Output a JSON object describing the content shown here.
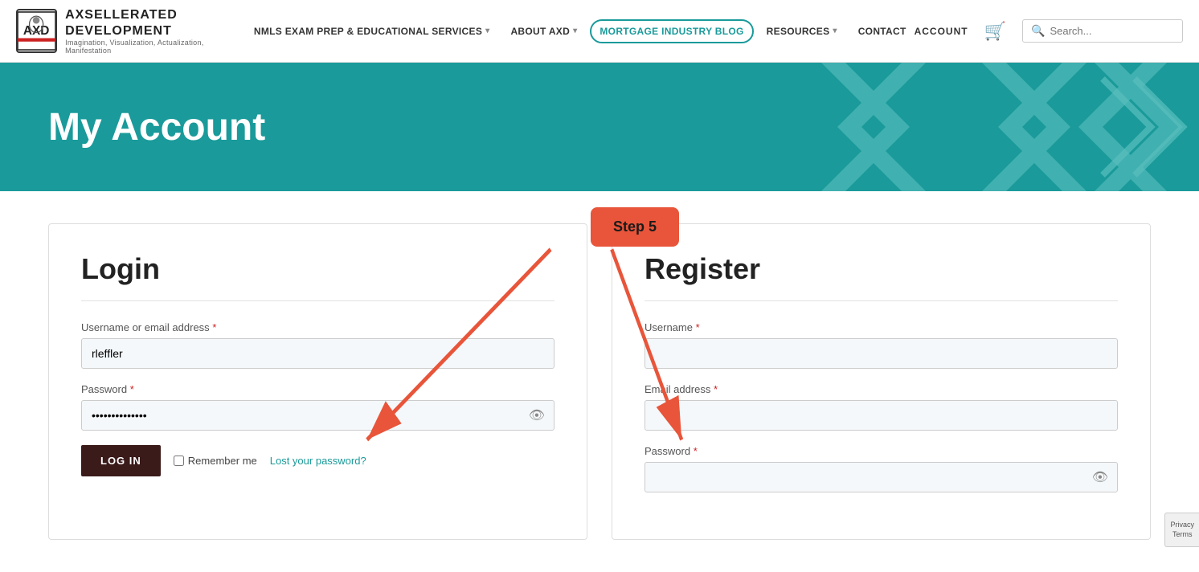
{
  "header": {
    "logo": {
      "abbr": "AXD",
      "title_line1": "AXSELLERATED",
      "title_line2": "DEVELOPMENT",
      "subtitle": "Imagination, Visualization, Actualization, Manifestation"
    },
    "nav": [
      {
        "id": "nmls",
        "label": "NMLS EXAM PREP & EDUCATIONAL SERVICES",
        "has_dropdown": true
      },
      {
        "id": "about",
        "label": "ABOUT AXD",
        "has_dropdown": true
      },
      {
        "id": "blog",
        "label": "MORTGAGE INDUSTRY BLOG",
        "has_dropdown": false,
        "outlined": true
      },
      {
        "id": "resources",
        "label": "RESOURCES",
        "has_dropdown": true
      },
      {
        "id": "contact",
        "label": "CONTACT",
        "has_dropdown": false
      }
    ],
    "account_label": "ACCOUNT",
    "search_placeholder": "Search..."
  },
  "hero": {
    "title": "My Account"
  },
  "annotation": {
    "step_label": "Step 5"
  },
  "login": {
    "title": "Login",
    "username_label": "Username or email address",
    "username_value": "rleffler",
    "password_label": "Password",
    "password_dots": "••••••••••••••••",
    "login_button": "LOG IN",
    "remember_label": "Remember me",
    "lost_password": "Lost your password?"
  },
  "register": {
    "title": "Register",
    "username_label": "Username",
    "email_label": "Email address",
    "password_label": "Password"
  },
  "privacy": {
    "line1": "Privacy",
    "line2": "Terms"
  }
}
